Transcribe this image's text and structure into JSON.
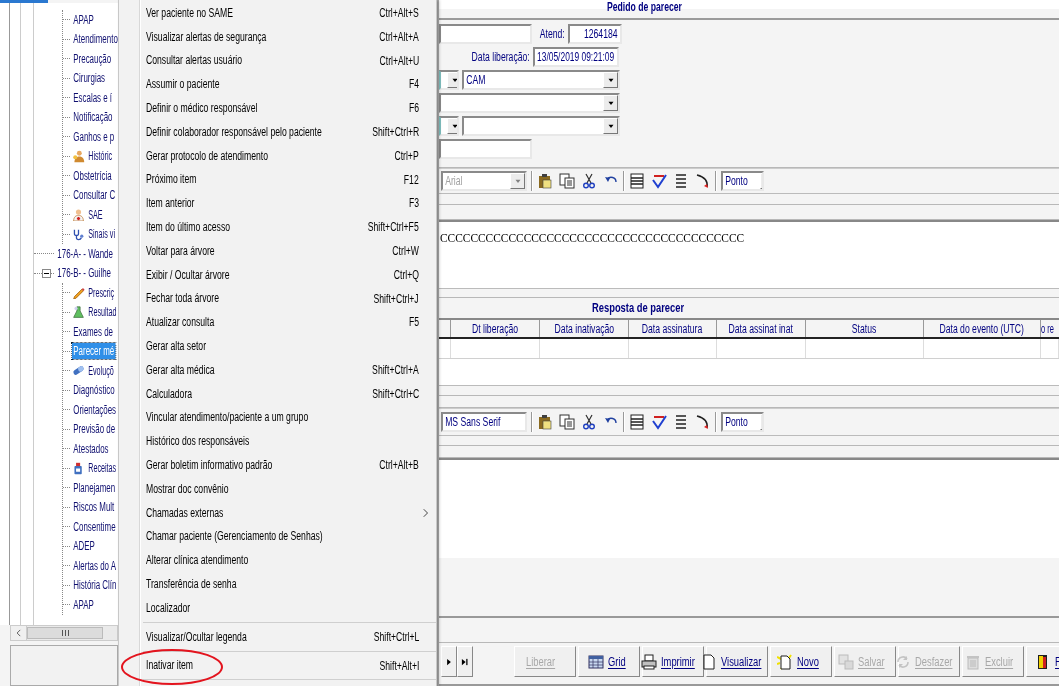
{
  "tree": {
    "continued_items": [
      {
        "label": "APAP",
        "kind": "plain",
        "selected": false
      },
      {
        "label": "Atendimento",
        "kind": "plain",
        "selected": false
      },
      {
        "label": "Precaução",
        "kind": "plain",
        "selected": false
      },
      {
        "label": "Cirurgias",
        "kind": "plain",
        "selected": false
      },
      {
        "label": "Escalas e í",
        "kind": "plain",
        "selected": false
      },
      {
        "label": "Notificação",
        "kind": "plain",
        "selected": false
      },
      {
        "label": "Ganhos e p",
        "kind": "plain",
        "selected": false
      },
      {
        "label": "Históric",
        "kind": "person",
        "selected": false
      },
      {
        "label": "Obstetrícia",
        "kind": "plain",
        "selected": false
      },
      {
        "label": "Consultar C",
        "kind": "plain",
        "selected": false
      },
      {
        "label": "SAE",
        "kind": "nurse",
        "selected": false
      },
      {
        "label": "Sinais vi",
        "kind": "stethoscope",
        "selected": false
      }
    ],
    "nodes": [
      {
        "label": "176-A-  - Wande",
        "selected": false
      },
      {
        "label": "176-B-  - Guilhe",
        "selected": false,
        "expanded": true,
        "children": [
          {
            "label": "Prescriç",
            "kind": "pencil",
            "selected": false
          },
          {
            "label": "Resultad",
            "kind": "flask",
            "selected": false
          },
          {
            "label": "Exames de",
            "kind": "plain",
            "selected": false
          },
          {
            "label": "Parecer mé",
            "kind": "plain",
            "selected": true
          },
          {
            "label": "Evoluçõ",
            "kind": "capsule",
            "selected": false
          },
          {
            "label": "Diagnóstico",
            "kind": "plain",
            "selected": false
          },
          {
            "label": "Orientações",
            "kind": "plain",
            "selected": false
          },
          {
            "label": "Previsão de",
            "kind": "plain",
            "selected": false
          },
          {
            "label": "Atestados",
            "kind": "plain",
            "selected": false
          },
          {
            "label": "Receitas",
            "kind": "bottle",
            "selected": false
          },
          {
            "label": "Planejamen",
            "kind": "plain",
            "selected": false
          },
          {
            "label": "Riscos Mult",
            "kind": "plain",
            "selected": false
          },
          {
            "label": "Consentime",
            "kind": "plain",
            "selected": false
          },
          {
            "label": "ADEP",
            "kind": "plain",
            "selected": false
          },
          {
            "label": "Alertas do A",
            "kind": "plain",
            "selected": false
          },
          {
            "label": "História Clín",
            "kind": "plain",
            "selected": false
          },
          {
            "label": "APAP",
            "kind": "plain",
            "selected": false
          }
        ]
      }
    ]
  },
  "context_menu": {
    "items": [
      {
        "kind": "item",
        "label": "Ver paciente no SAME",
        "shortcut": "Ctrl+Alt+S",
        "circled": false
      },
      {
        "kind": "item",
        "label": "Visualizar alertas de segurança",
        "shortcut": "Ctrl+Alt+A",
        "circled": false
      },
      {
        "kind": "item",
        "label": "Consultar alertas usuário",
        "shortcut": "Ctrl+Alt+U",
        "circled": false
      },
      {
        "kind": "item",
        "label": "Assumir o paciente",
        "shortcut": "F4",
        "circled": false
      },
      {
        "kind": "item",
        "label": "Definir o médico responsável",
        "shortcut": "F6",
        "circled": false
      },
      {
        "kind": "item",
        "label": "Definir colaborador responsável pelo paciente",
        "shortcut": "Shift+Ctrl+R",
        "circled": false
      },
      {
        "kind": "item",
        "label": "Gerar protocolo de atendimento",
        "shortcut": "Ctrl+P",
        "circled": false
      },
      {
        "kind": "item",
        "label": "Próximo item",
        "shortcut": "F12",
        "circled": false
      },
      {
        "kind": "item",
        "label": "Item anterior",
        "shortcut": "F3",
        "circled": false
      },
      {
        "kind": "item",
        "label": "Item do último acesso",
        "shortcut": "Shift+Ctrl+F5",
        "circled": false
      },
      {
        "kind": "item",
        "label": "Voltar para árvore",
        "shortcut": "Ctrl+W",
        "circled": false
      },
      {
        "kind": "item",
        "label": "Exibir / Ocultar árvore",
        "shortcut": "Ctrl+Q",
        "circled": false
      },
      {
        "kind": "item",
        "label": "Fechar toda árvore",
        "shortcut": "Shift+Ctrl+J",
        "circled": false
      },
      {
        "kind": "item",
        "label": "Atualizar consulta",
        "shortcut": "F5",
        "circled": false
      },
      {
        "kind": "item",
        "label": "Gerar alta setor",
        "circled": false
      },
      {
        "kind": "item",
        "label": "Gerar alta médica",
        "shortcut": "Shift+Ctrl+A",
        "circled": false
      },
      {
        "kind": "item",
        "label": "Calculadora",
        "shortcut": "Shift+Ctrl+C",
        "circled": false
      },
      {
        "kind": "item",
        "label": "Vincular atendimento/paciente a um grupo",
        "circled": false
      },
      {
        "kind": "item",
        "label": "Histórico dos responsáveis",
        "circled": false
      },
      {
        "kind": "item",
        "label": "Gerar boletim informativo padrão",
        "shortcut": "Ctrl+Alt+B",
        "circled": false
      },
      {
        "kind": "item",
        "label": "Mostrar doc convênio",
        "circled": false
      },
      {
        "kind": "submenu",
        "label": "Chamadas externas",
        "circled": false
      },
      {
        "kind": "item",
        "label": "Chamar paciente (Gerenciamento de Senhas)",
        "circled": false
      },
      {
        "kind": "item",
        "label": "Alterar clínica atendimento",
        "circled": false
      },
      {
        "kind": "item",
        "label": "Transferência de senha",
        "circled": false
      },
      {
        "kind": "item",
        "label": "Localizador",
        "circled": false
      },
      {
        "kind": "separator"
      },
      {
        "kind": "item",
        "label": "Visualizar/Ocultar legenda",
        "shortcut": "Shift+Ctrl+L",
        "circled": false
      },
      {
        "kind": "separator"
      },
      {
        "kind": "item",
        "label": "Inativar item",
        "shortcut": "Shift+Alt+I",
        "circled": true
      },
      {
        "kind": "separator"
      }
    ]
  },
  "order_form": {
    "title": "Pedido de parecer",
    "atend_label": "Atend:",
    "atend_value": "1264184",
    "release_label": "Data liberação:",
    "release_value": "13/05/2019 09:21:09",
    "clinic_value": "CAM"
  },
  "editor_toolbars": [
    {
      "font": "Arial",
      "font_disabled": true,
      "unit": "Ponto"
    },
    {
      "font": "MS Sans Serif",
      "font_disabled": false,
      "unit": "Ponto"
    }
  ],
  "order_text": "CCCCCCCCCCCCCCCCCCCCCCCCCCCCCCCCCCCCCCCC",
  "response": {
    "title": "Resposta de parecer",
    "columns": [
      "Dt liberação",
      "Data inativação",
      "Data assinatura",
      "Data assinat inat",
      "Status",
      "Data do evento (UTC)",
      "o re"
    ]
  },
  "buttons": [
    {
      "label": "Liberar",
      "kind": "text",
      "disabled": true
    },
    {
      "label": "Grid",
      "kind": "grid",
      "disabled": false
    },
    {
      "label": "Imprimir",
      "kind": "printer",
      "disabled": false
    },
    {
      "label": "Visualizar",
      "kind": "page",
      "disabled": false
    },
    {
      "label": "Novo",
      "kind": "new",
      "disabled": false
    },
    {
      "label": "Salvar",
      "kind": "save",
      "disabled": true
    },
    {
      "label": "Desfazer",
      "kind": "refresh",
      "disabled": true
    },
    {
      "label": "Excluir",
      "kind": "trash",
      "disabled": true
    },
    {
      "label": "F",
      "kind": "exit",
      "disabled": false
    }
  ]
}
